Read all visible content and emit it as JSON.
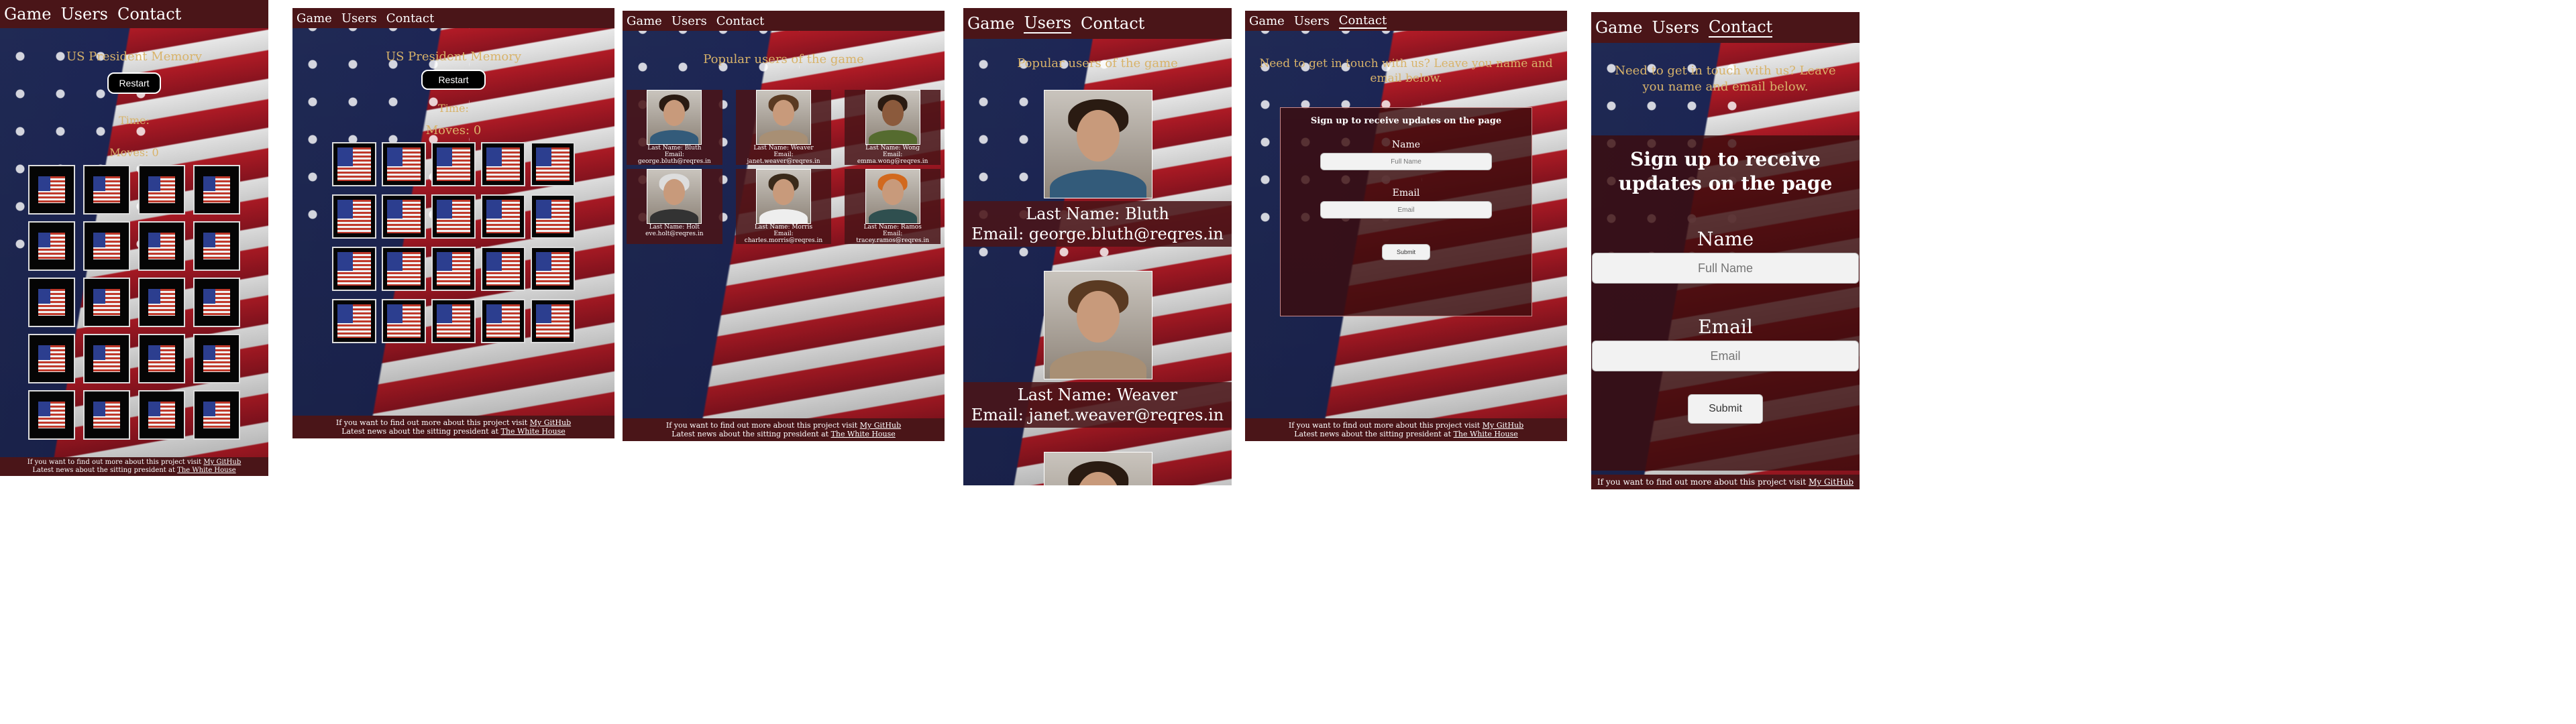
{
  "nav": {
    "game": "Game",
    "users": "Users",
    "contact": "Contact"
  },
  "game": {
    "title": "US President Memory",
    "restart": "Restart",
    "time_label": "Time:",
    "moves_label": "Moves: 0"
  },
  "users": {
    "heading": "Popular users of the game",
    "list": [
      {
        "last": "Last Name: Bluth",
        "email_label": "Email:",
        "email": "george.bluth@reqres.in"
      },
      {
        "last": "Last Name: Weaver",
        "email_label": "Email:",
        "email": "janet.weaver@reqres.in"
      },
      {
        "last": "Last Name: Wong",
        "email_label": "Email:",
        "email": "emma.wong@reqres.in"
      },
      {
        "last": "Last Name: Holt",
        "email_label": "Email:",
        "email": "eve.holt@reqres.in"
      },
      {
        "last": "Last Name: Morris",
        "email_label": "Email:",
        "email": "charles.morris@reqres.in"
      },
      {
        "last": "Last Name: Ramos",
        "email_label": "Email:",
        "email": "tracey.ramos@reqres.in"
      }
    ],
    "mobile_1_last": "Last Name: Bluth",
    "mobile_1_email": "Email: george.bluth@reqres.in",
    "mobile_2_last": "Last Name: Weaver",
    "mobile_2_email": "Email: janet.weaver@reqres.in"
  },
  "contact": {
    "intro": "Need to get in touch with us? Leave you name and email below.",
    "form_title": "Sign up to receive updates on the page",
    "name_label": "Name",
    "name_placeholder": "Full Name",
    "email_label": "Email",
    "email_placeholder": "Email",
    "submit": "Submit"
  },
  "footer": {
    "line1_text": "If you want to find out more about this project visit",
    "line1_link": "My GitHub",
    "line2_text": "Latest news about the sitting president at",
    "line2_link": "The White House"
  },
  "colors": {
    "nav_bg": "#4a1518",
    "gold": "#d8b36a",
    "card_bg": "#050505"
  }
}
